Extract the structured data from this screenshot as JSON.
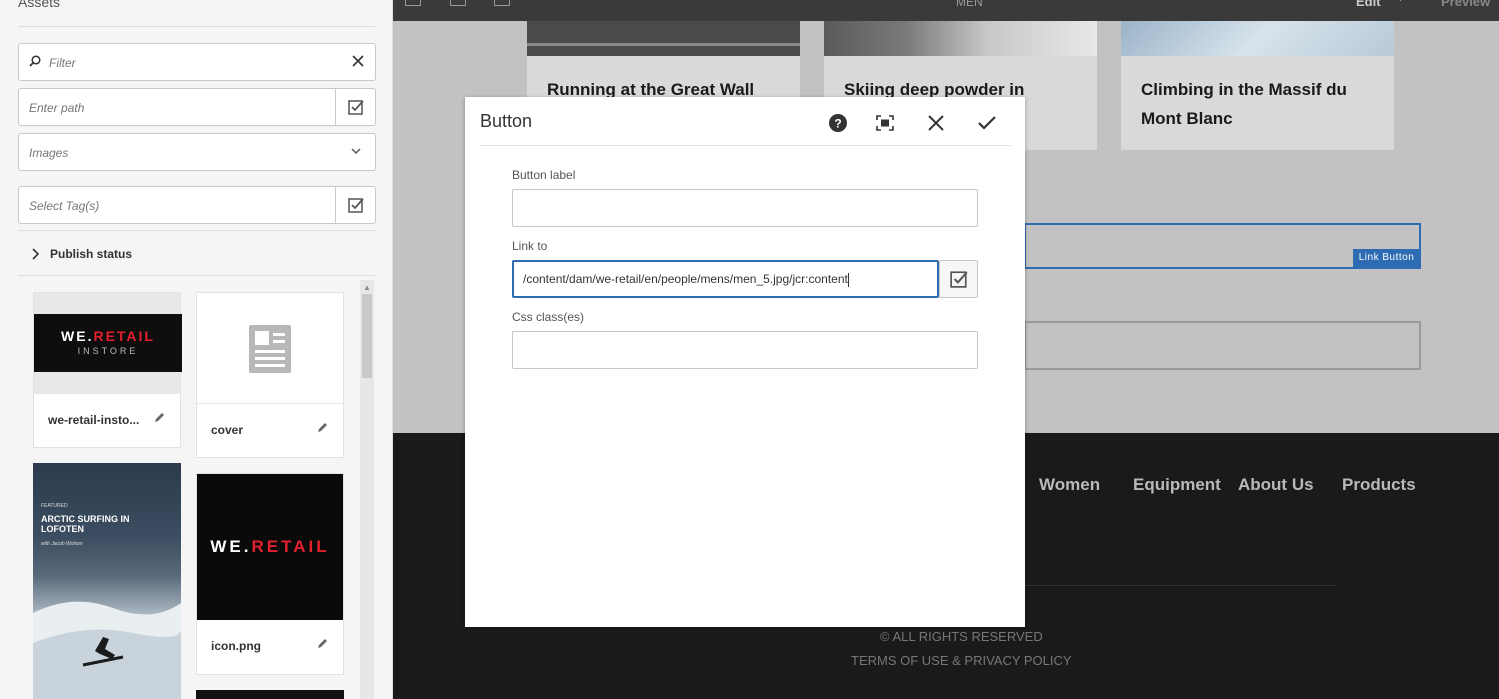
{
  "assets_panel": {
    "title": "Assets",
    "filter_placeholder": "Filter",
    "path_placeholder": "Enter path",
    "type_select": "Images",
    "tags_placeholder": "Select Tag(s)",
    "publish_status": "Publish status",
    "cards": [
      {
        "name": "we-retail-insto...",
        "logo_brand": "WE.RETAIL",
        "logo_sub": "INSTORE"
      },
      {
        "name": "cover"
      },
      {
        "name": "ARCTIC SURFING IN LOFOTEN",
        "featured": "FEATURED",
        "byline": "with Jacob Wolson"
      },
      {
        "name": "icon.png",
        "logo_brand": "WE.RETAIL"
      }
    ]
  },
  "topbar": {
    "center": "MEN",
    "mode": "Edit",
    "preview": "Preview"
  },
  "page": {
    "cards": [
      {
        "title": "Running at the Great Wall"
      },
      {
        "title": "Skiing deep powder in"
      },
      {
        "title": "Climbing in the Massif du Mont Blanc"
      }
    ],
    "link_button_tag": "Link Button",
    "nav": [
      "Women",
      "Equipment",
      "About Us",
      "Products"
    ],
    "copyright": "© ALL RIGHTS RESERVED",
    "terms": "TERMS OF USE & PRIVACY POLICY"
  },
  "dialog": {
    "title": "Button",
    "button_label_label": "Button label",
    "button_label_value": "",
    "link_to_label": "Link to",
    "link_to_value": "/content/dam/we-retail/en/people/mens/men_5.jpg/jcr:content",
    "css_label": "Css class(es)",
    "css_value": ""
  },
  "colors": {
    "accent": "#2d6cb3",
    "brand_red": "#e4202e",
    "footer_bg": "#1a1a1a"
  }
}
